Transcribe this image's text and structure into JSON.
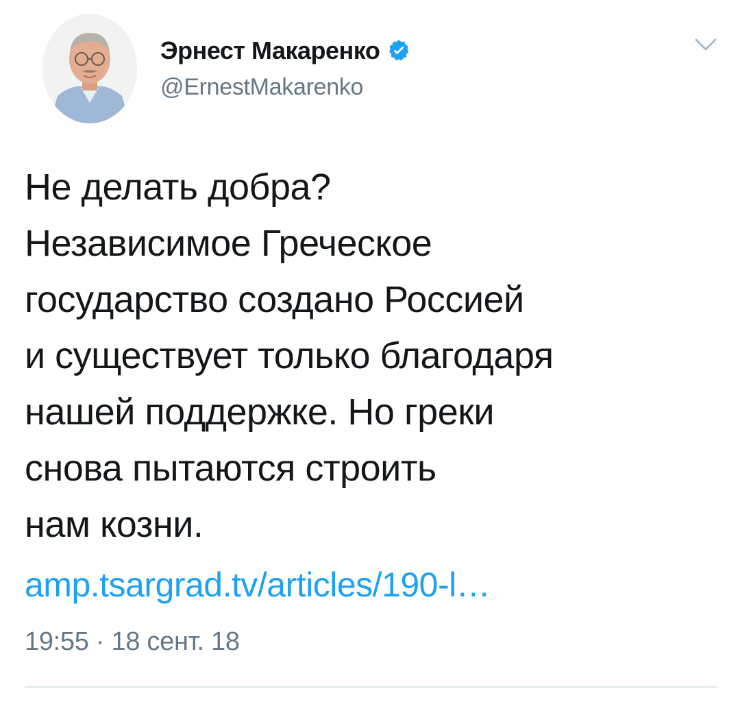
{
  "author": {
    "display_name": "Эрнест Макаренко",
    "handle": "@ErnestMakarenko",
    "verified": true,
    "avatar_icon": "person-photo-avatar"
  },
  "tweet": {
    "lines": [
      "Не делать добра?",
      "Независимое Греческое",
      "государство создано Россией",
      "и существует только благодаря",
      "нашей поддержке. Но греки",
      "снова пытаются строить",
      "нам козни."
    ],
    "link": "amp.tsargrad.tv/articles/190-l…",
    "time": "19:55",
    "separator": "·",
    "date": "18 сент. 18"
  },
  "colors": {
    "link": "#1da1f2",
    "verified": "#1da1f2",
    "muted": "#657786",
    "text": "#14171a",
    "divider": "#e1e8ed"
  },
  "icons": {
    "verified": "verified-badge-icon",
    "menu": "chevron-down-icon"
  }
}
